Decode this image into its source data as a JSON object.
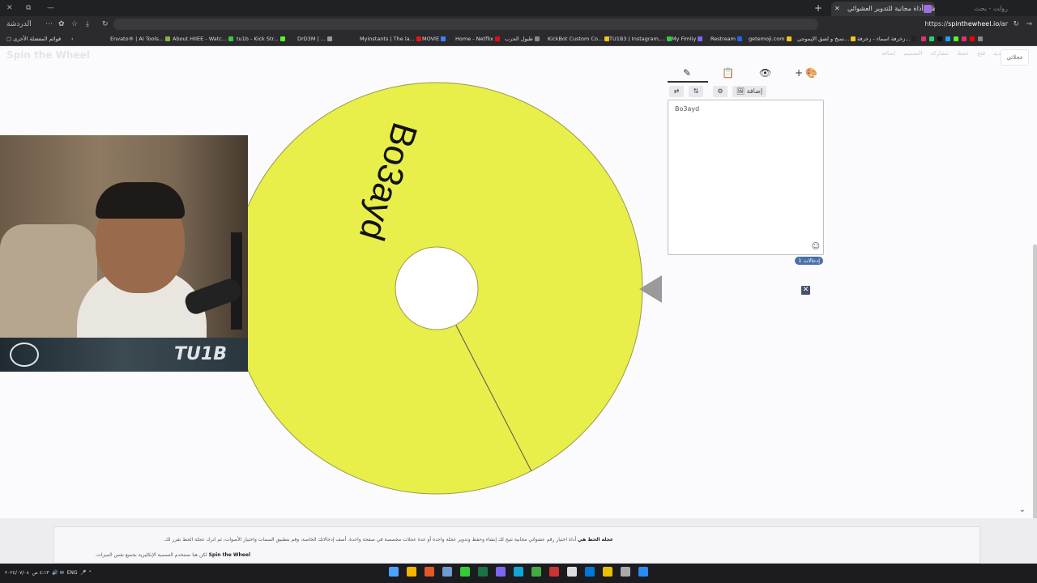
{
  "browser": {
    "tab_title": "عجلة الحظ – أداة مجانية للتدوير العشوائي",
    "tab2_title": "رولت - بحث",
    "url_prefix": "https://",
    "url_domain": "spinthewheel.io",
    "url_path": "/ar",
    "bookmarks": [
      {
        "label": "Envato® | AI Tools...",
        "color": "#82b541"
      },
      {
        "label": "About HIIEE - Watc...",
        "color": "#2ecc40"
      },
      {
        "label": "tu1b - Kick Str...",
        "color": "#53fc18"
      },
      {
        "label": "DrD3M | ...",
        "color": "#999999"
      },
      {
        "label": "Myinstants | The la...",
        "color": "#222222"
      },
      {
        "label": "MOVIE",
        "color": "#3b82f6"
      },
      {
        "label": "Home - Netflix",
        "color": "#e50914"
      },
      {
        "label": "طبول الحرب",
        "color": "#888888"
      },
      {
        "label": "KickBot Custom Co...",
        "color": "#f5c518"
      },
      {
        "label": "TU1B3 | Instagram,...",
        "color": "#e1306c"
      },
      {
        "label": "My Fimliy",
        "color": "#7b68ee"
      },
      {
        "label": "Restream",
        "color": "#2563eb"
      },
      {
        "label": "getemoji.com",
        "color": "#f5c518"
      },
      {
        "label": "نسخ و لصق الإيموجي...",
        "color": "#f5c518"
      },
      {
        "label": "زخرفة اسماء - زخرفة...",
        "color": "#222222"
      }
    ],
    "other_bookmarks": "قوائم المفضلة الأخرى",
    "profile_label": "الدردشة"
  },
  "site": {
    "logo": "Spin the Wheel",
    "nav": [
      "جديد",
      "فتح",
      "حفظ",
      "مشاركة",
      "التصميم",
      "إضافة"
    ],
    "lang_button": "عجلاتي"
  },
  "wheel": {
    "entry": "Bo3ayd",
    "color": "#e8ee4a",
    "border_color": "#9a9a4a",
    "pointer_color": "#9a9a9a"
  },
  "editor": {
    "tab_icons": [
      "pencil-icon",
      "clipboard-icon",
      "eye-off-icon",
      "plus-icon",
      "color-wheel-icon"
    ],
    "tools": [
      "⇄",
      "⇅",
      "⚙",
      "🖼 إضافة"
    ],
    "entries_text": "Bo3ayd",
    "count_badge": "إدخالات 1"
  },
  "footer": {
    "para1_bold": "عجلة الحظ هي",
    "para1_text": " أداة اختيار رقم عشوائي مجانية تتيح لك إنشاء وحفظ وتدوير عجلة واحدة أو عدة عجلات مخصصة في صفحة واحدة. أضف إدخالاتك الخاصة، وقم بتطبيق السمات واختيار الأصوات، ثم اترك عجلة الحظ تقرر لك.",
    "para2_bold": "Spin the Wheel",
    "para2_text": "لكن هنا نستخدم التسمية الإنكليزية بجميع نفس الميزات."
  },
  "taskbar": {
    "lang": "ENG",
    "time": "٤:١٣ ص",
    "date": "٢٠٢٤/٠٧/٠٨"
  }
}
